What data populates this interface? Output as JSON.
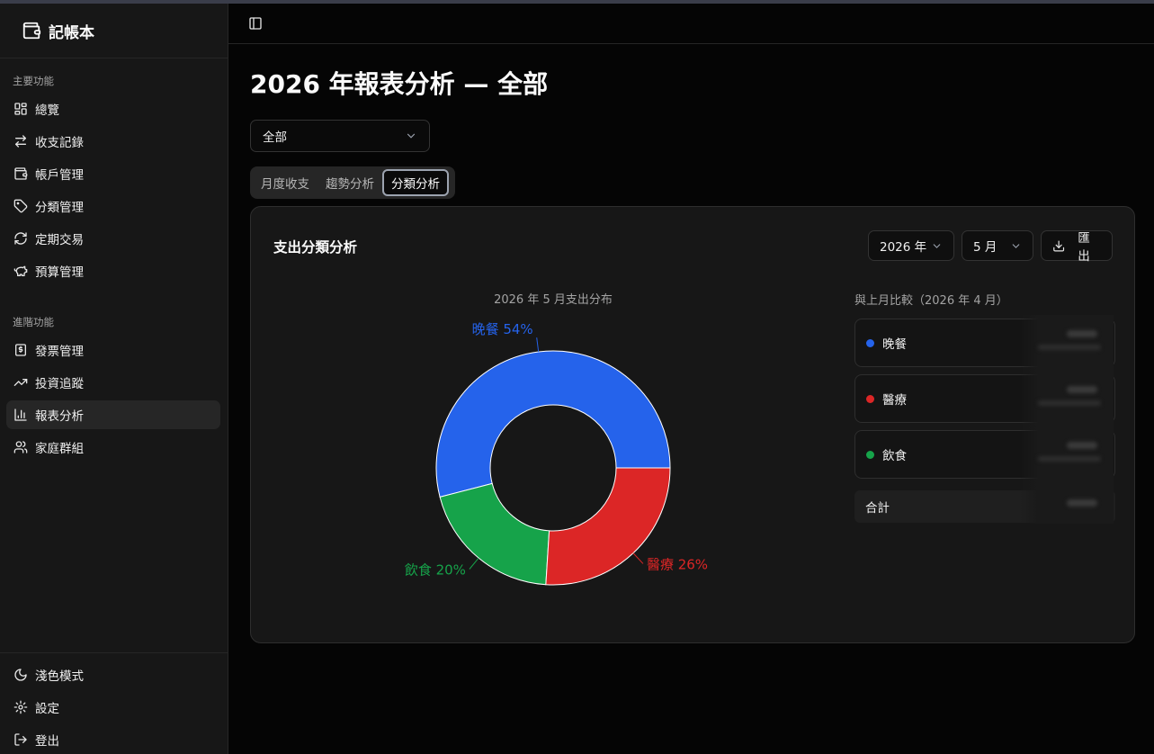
{
  "sidebar": {
    "brand": "記帳本",
    "main_section": "主要功能",
    "main_items": [
      {
        "label": "總覽",
        "icon": "dashboard-icon"
      },
      {
        "label": "收支記錄",
        "icon": "arrows-swap-icon"
      },
      {
        "label": "帳戶管理",
        "icon": "wallet-icon"
      },
      {
        "label": "分類管理",
        "icon": "tag-icon"
      },
      {
        "label": "定期交易",
        "icon": "refresh-icon"
      },
      {
        "label": "預算管理",
        "icon": "piggy-bank-icon"
      }
    ],
    "advanced_section": "進階功能",
    "advanced_items": [
      {
        "label": "發票管理",
        "icon": "receipt-icon"
      },
      {
        "label": "投資追蹤",
        "icon": "trending-up-icon"
      },
      {
        "label": "報表分析",
        "icon": "bar-chart-icon",
        "active": true
      },
      {
        "label": "家庭群組",
        "icon": "users-icon"
      }
    ],
    "bottom_items": [
      {
        "label": "淺色模式",
        "icon": "moon-icon"
      },
      {
        "label": "設定",
        "icon": "gear-icon"
      },
      {
        "label": "登出",
        "icon": "logout-icon"
      }
    ]
  },
  "page": {
    "title": "2026 年報表分析 — 全部",
    "book_select": "全部",
    "tabs": [
      "月度收支",
      "趨勢分析",
      "分類分析"
    ],
    "active_tab": "分類分析"
  },
  "card": {
    "title": "支出分類分析",
    "year_select": "2026 年",
    "month_select": "5 月",
    "export_label": "匯出",
    "compare_title": "與上月比較（2026 年 4 月）",
    "compare_items": [
      {
        "label": "晚餐",
        "color": "#2563eb"
      },
      {
        "label": "醫療",
        "color": "#dc2626"
      },
      {
        "label": "飲食",
        "color": "#16a34a"
      }
    ],
    "total_label": "合計"
  },
  "chart_data": {
    "type": "pie",
    "title": "2026 年 5 月支出分布",
    "categories": [
      "晚餐",
      "飲食",
      "醫療"
    ],
    "values": [
      54,
      20,
      26
    ],
    "labels": [
      "晚餐 54%",
      "飲食 20%",
      "醫療 26%"
    ],
    "colors": [
      "#2563eb",
      "#16a34a",
      "#dc2626"
    ],
    "donut": true
  }
}
